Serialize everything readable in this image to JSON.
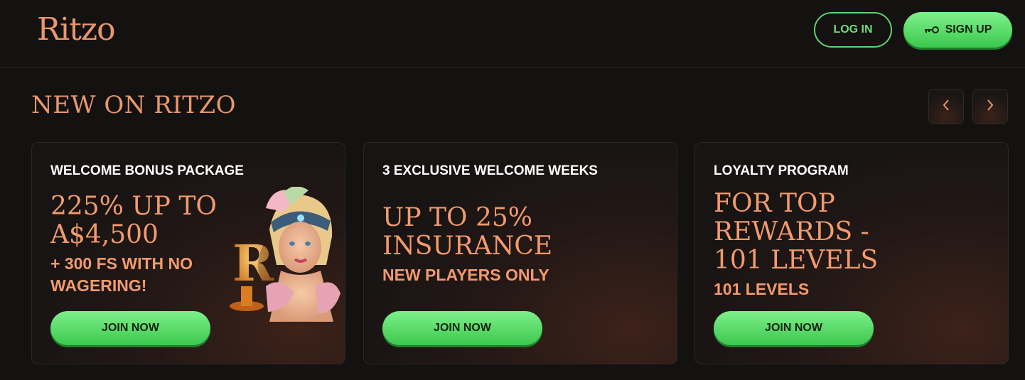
{
  "header": {
    "logo": "Ritzo",
    "login_label": "LOG IN",
    "signup_label": "SIGN UP",
    "signup_icon": "key-icon"
  },
  "section": {
    "title": "NEW ON RITZO",
    "prev_icon": "chevron-left-icon",
    "next_icon": "chevron-right-icon"
  },
  "cards": [
    {
      "label": "WELCOME BONUS PACKAGE",
      "headline": "225% UP TO A$4,500",
      "sub": "+ 300 FS WITH NO WAGERING!",
      "button": "JOIN NOW"
    },
    {
      "label": "3 EXCLUSIVE WELCOME WEEKS",
      "headline": "UP TO 25% INSURANCE",
      "sub": "NEW PLAYERS ONLY",
      "button": "JOIN NOW"
    },
    {
      "label": "LOYALTY PROGRAM",
      "headline": "FOR TOP REWARDS - 101 LEVELS",
      "sub": "101 LEVELS",
      "button": "JOIN NOW"
    }
  ],
  "colors": {
    "background": "#141211",
    "accent": "#e9976c",
    "button_green": "#4fd85f"
  }
}
